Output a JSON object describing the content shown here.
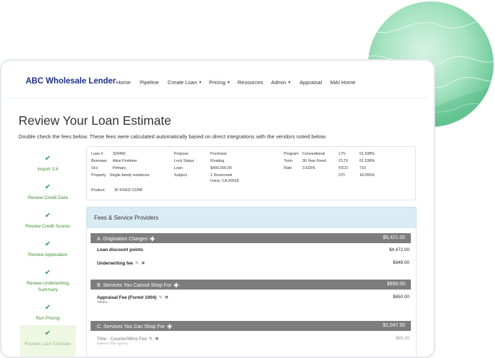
{
  "brand": "ABC Wholesale Lender",
  "nav": [
    {
      "label": "Home",
      "caret": false
    },
    {
      "label": "Pipeline",
      "caret": false
    },
    {
      "label": "Create Loan",
      "caret": true
    },
    {
      "label": "Pricing",
      "caret": true
    },
    {
      "label": "Resources",
      "caret": false
    },
    {
      "label": "Admin",
      "caret": true
    },
    {
      "label": "Appraisal",
      "caret": false
    },
    {
      "label": "MAI Home",
      "caret": false
    }
  ],
  "page": {
    "title": "Review Your Loan Estimate",
    "subtitle": "Double check the fees below. These fees were calculated automatically based on direct integrations with the vendors noted below."
  },
  "steps": [
    {
      "label": "Import 3.4"
    },
    {
      "label": "Review Credit Data"
    },
    {
      "label": "Review Credit Scores"
    },
    {
      "label": "Review Application"
    },
    {
      "label": "Review Underwriting Summary"
    },
    {
      "label": "Run Pricing"
    },
    {
      "label": "Review Loan Estimate"
    }
  ],
  "loan": {
    "loan_no_label": "Loan #",
    "loan_no": "329465",
    "borrower_label": "Borrower",
    "borrower": "Alice Firstimer",
    "occ_label": "Occ",
    "occ": "Primary",
    "property_label": "Property",
    "property": "Single family residence",
    "product_label": "Product",
    "product": "30 FIXED CONF",
    "purpose_label": "Purpose",
    "purpose": "Purchase",
    "lock_label": "Lock Status",
    "lock": "Floating",
    "amount_label": "Loan",
    "amount": "$400,000.00",
    "subject_label": "Subject",
    "subject_line1": "1 Dovecreek",
    "subject_line2": "Irvine, CA 92618",
    "program_label": "Program",
    "program": "Conventional",
    "term_label": "Term",
    "term": "30 Year Fixed",
    "rate_label": "Rate",
    "rate": "3.625%",
    "ltv_label": "LTV",
    "ltv": "61.538%",
    "cltv_label": "CLTV",
    "cltv": "61.538%",
    "fico_label": "FICO",
    "fico": "710",
    "dti_label": "DTI",
    "dti": "18.055%"
  },
  "fees": {
    "header": "Fees & Service Providers",
    "sections": [
      {
        "title": "A. Origination Charges",
        "total": "$5,421.00",
        "items": [
          {
            "name": "Loan discount points",
            "amount": "$4,472.00",
            "provider": ""
          },
          {
            "name": "Underwriting fee",
            "amount": "$949.00",
            "provider": ""
          }
        ]
      },
      {
        "title": "B. Services You Cannot Shop For",
        "total": "$650.00",
        "items": [
          {
            "name": "Appraisal Fee (Form# 1004)",
            "amount": "$650.00",
            "provider": "Triserv"
          }
        ]
      },
      {
        "title": "C. Services You Can Shop For",
        "total": "$1,047.50",
        "items": [
          {
            "name": "Title - Courier/Wire Fee",
            "amount": "$85.00",
            "provider": "Nations Title Agency"
          }
        ]
      }
    ]
  },
  "colors": {
    "brand": "#1b2f94",
    "step_green": "#3f8f2f",
    "section_bar": "#7d7d7d",
    "fees_header_bg": "#d9ecf3",
    "circle_green": "#7fd3a6"
  }
}
